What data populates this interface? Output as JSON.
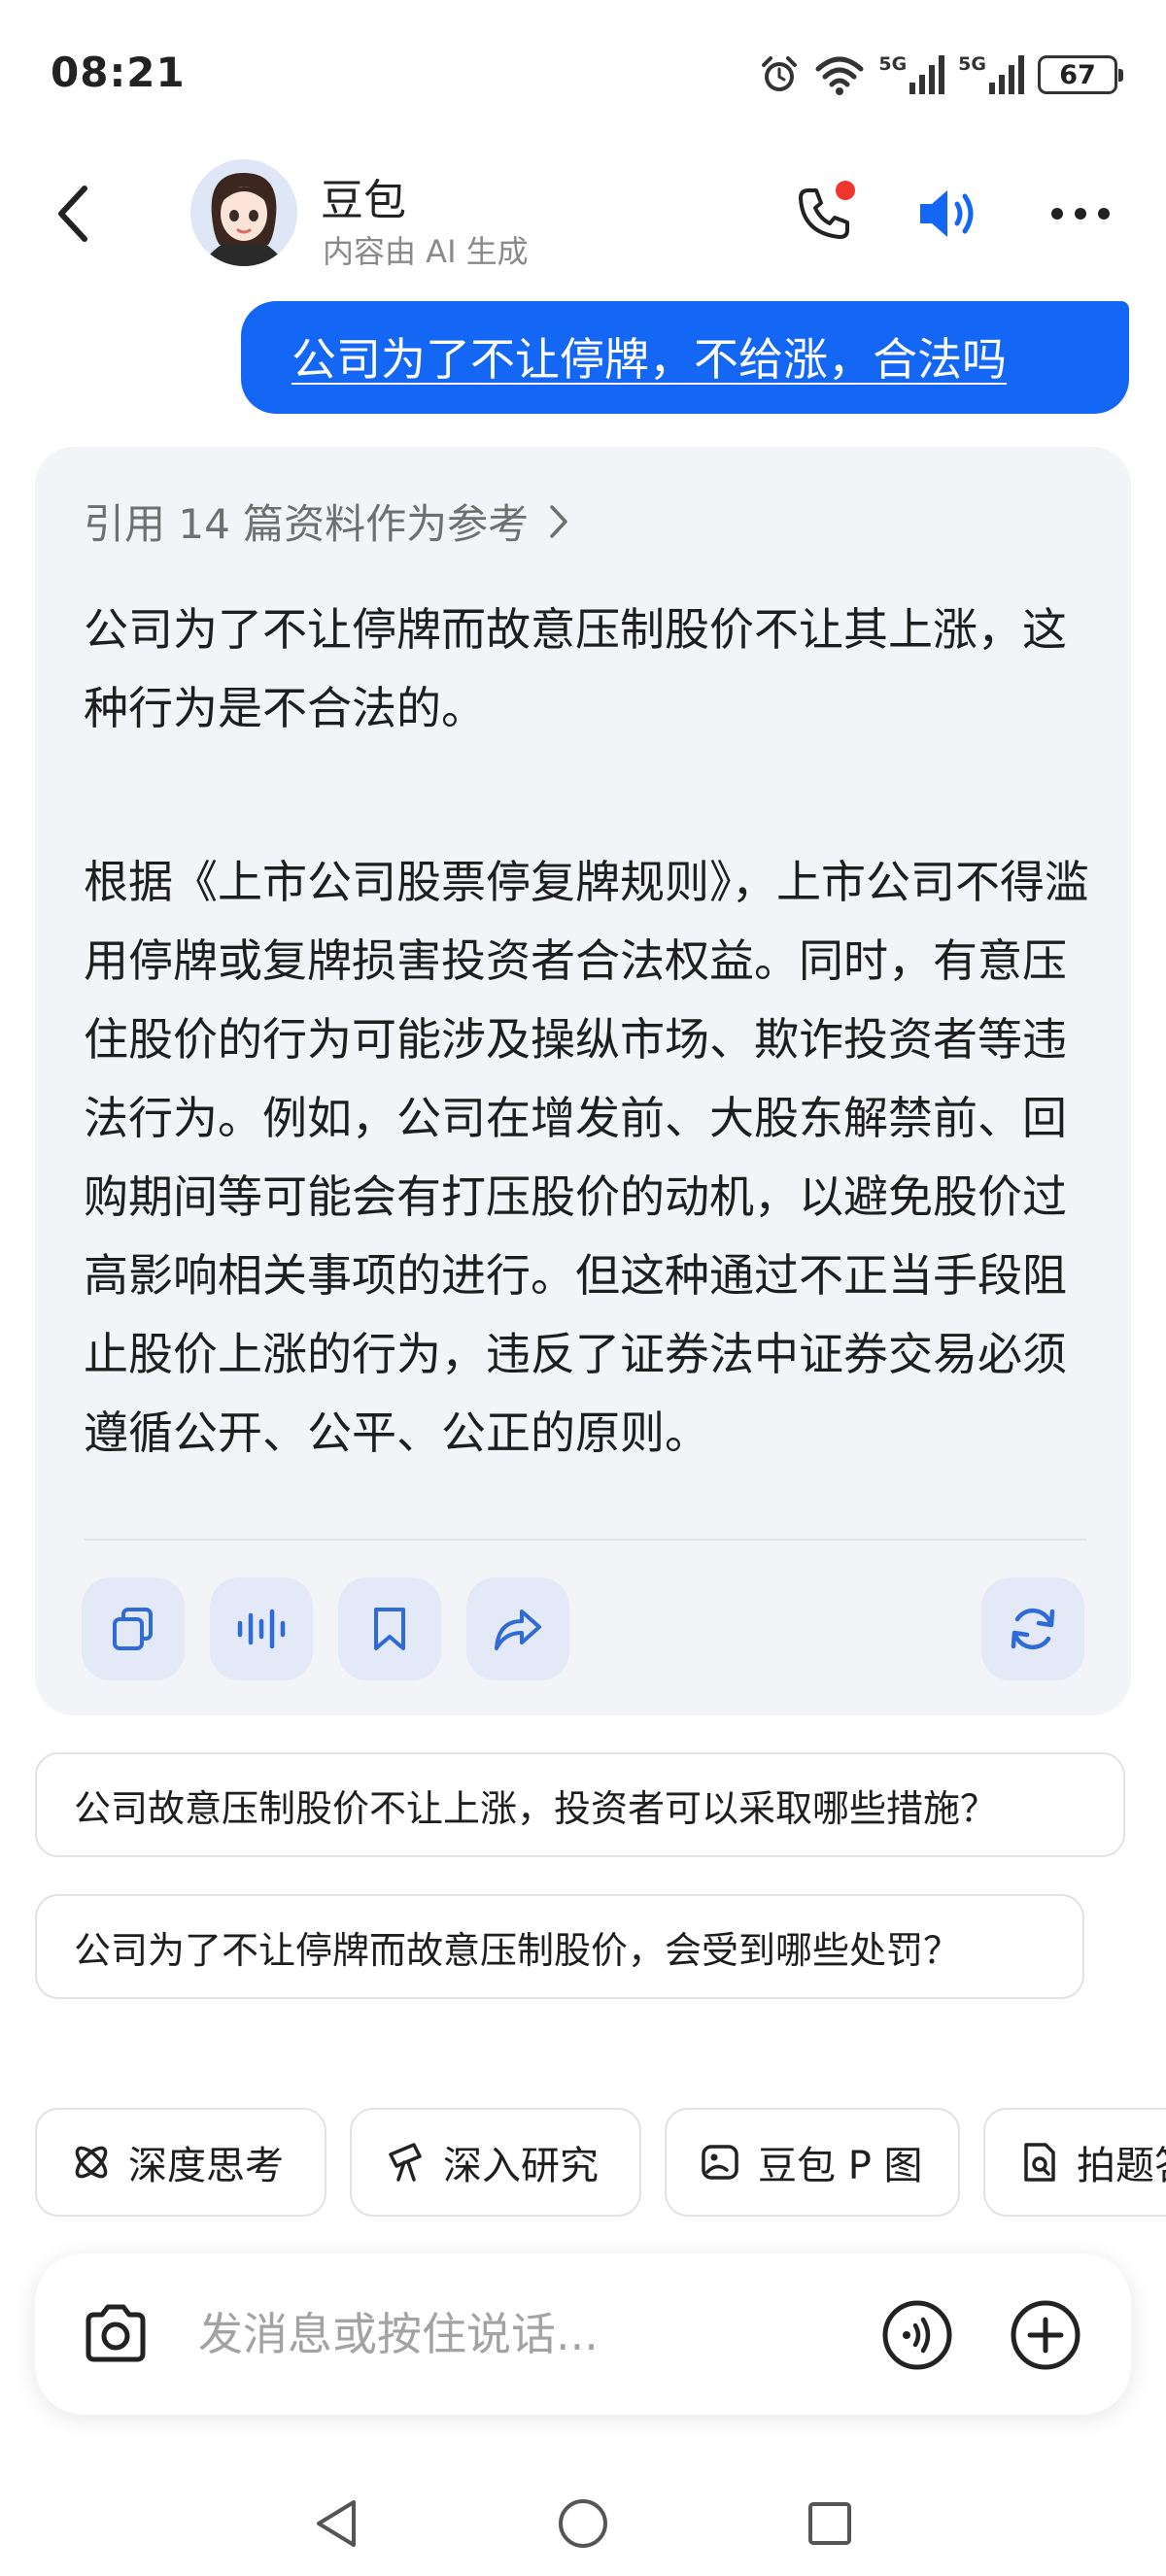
{
  "status_bar": {
    "time": "08:21",
    "network_1": "5G",
    "network_2": "5G",
    "battery": "67"
  },
  "header": {
    "name": "豆包",
    "subtitle": "内容由 AI 生成"
  },
  "user_message": "公司为了不让停牌，不给涨，合法吗",
  "ai_reply": {
    "reference": "引用 14 篇资料作为参考",
    "paragraph_1": "公司为了不让停牌而故意压制股价不让其上涨，这种行为是不合法的。",
    "paragraph_2": "根据《上市公司股票停复牌规则》，上市公司不得滥用停牌或复牌损害投资者合法权益。同时，有意压住股价的行为可能涉及操纵市场、欺诈投资者等违法行为。例如，公司在增发前、大股东解禁前、回购期间等可能会有打压股价的动机，以避免股价过高影响相关事项的进行。但这种通过不正当手段阻止股价上涨的行为，违反了证券法中证券交易必须遵循公开、公平、公正的原则。"
  },
  "suggestions": [
    "公司故意压制股价不让上涨，投资者可以采取哪些措施？",
    "公司为了不让停牌而故意压制股价，会受到哪些处罚？"
  ],
  "chips": [
    "深度思考",
    "深入研究",
    "豆包 P 图",
    "拍题答疑"
  ],
  "input": {
    "placeholder": "发消息或按住说话..."
  },
  "colors": {
    "accent": "#1466f5",
    "card_bg": "#f3f4f7",
    "action_bg": "#e3e9f6",
    "notification_dot": "#f0352e"
  }
}
